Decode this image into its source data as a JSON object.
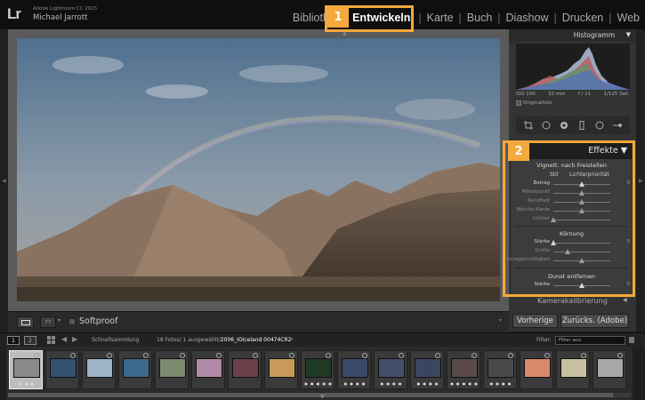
{
  "app": {
    "logo": "Lr",
    "version": "Adobe Lightroom CC 2015",
    "user": "Michael Jarrott"
  },
  "modules": {
    "library": "Bibliothek",
    "develop": "Entwickeln",
    "map": "Karte",
    "book": "Buch",
    "slideshow": "Diashow",
    "print": "Drucken",
    "web": "Web"
  },
  "callouts": {
    "one": "1",
    "two": "2"
  },
  "toolbar": {
    "yy_label": "YY",
    "softproof": "Softproof"
  },
  "histogram": {
    "title": "Histogramm",
    "iso": "ISO 100",
    "focal": "32 mm",
    "aperture": "f / 11",
    "shutter": "1/125 Sek.",
    "original_photo": "Originalfoto"
  },
  "effects": {
    "title": "Effekte",
    "vignette_title": "Vignett. nach Freistellen",
    "style_label": "Stil",
    "style_value": "Lichterpriorität",
    "vignette_rows": [
      {
        "label": "Betrag",
        "value": "0",
        "level": 0.5,
        "active": true
      },
      {
        "label": "Mittelpunkt",
        "value": "",
        "level": 0.5,
        "active": false
      },
      {
        "label": "Rundheit",
        "value": "",
        "level": 0.5,
        "active": false
      },
      {
        "label": "Weiche Kante",
        "value": "",
        "level": 0.5,
        "active": false
      },
      {
        "label": "Lichter",
        "value": "",
        "level": 0.0,
        "active": false
      }
    ],
    "grain_title": "Körnung",
    "grain_rows": [
      {
        "label": "Stärke",
        "value": "0",
        "level": 0.0,
        "active": true
      },
      {
        "label": "Größe",
        "value": "",
        "level": 0.25,
        "active": false
      },
      {
        "label": "Unregelmäßigkeit",
        "value": "",
        "level": 0.5,
        "active": false
      }
    ],
    "dehaze_title": "Dunst entfernen",
    "dehaze_rows": [
      {
        "label": "Stärke",
        "value": "0",
        "level": 0.5,
        "active": true
      }
    ]
  },
  "calibration": {
    "label": "Kamerakalibrierung"
  },
  "buttons": {
    "previous": "Vorherige",
    "reset": "Zurücks. (Adobe)"
  },
  "filmbar": {
    "screen1": "1",
    "screen2": "2",
    "collection": "Schnellsammlung",
    "count": "18 Fotos/ 1 ausgewählt/",
    "file": "2006_IOIceland 00474CR2",
    "filter_label": "Filter:",
    "filter_value": "Filter aus"
  },
  "filmstrip": {
    "thumbs": [
      {
        "color": "#8a8a8a",
        "stars": "● ● ●",
        "selected": true
      },
      {
        "color": "#35506e",
        "stars": "",
        "selected": false
      },
      {
        "color": "#9cb3c7",
        "stars": "",
        "selected": false
      },
      {
        "color": "#3c6a8f",
        "stars": "",
        "selected": false
      },
      {
        "color": "#7a8b70",
        "stars": "",
        "selected": false
      },
      {
        "color": "#b08aa8",
        "stars": "",
        "selected": false
      },
      {
        "color": "#6b3e4a",
        "stars": "",
        "selected": false
      },
      {
        "color": "#c79a5a",
        "stars": "",
        "selected": false
      },
      {
        "color": "#1f3a22",
        "stars": "● ● ● ● ●",
        "selected": false
      },
      {
        "color": "#3a4a6a",
        "stars": "● ● ● ●",
        "selected": false
      },
      {
        "color": "#44506a",
        "stars": "● ● ● ●",
        "selected": false
      },
      {
        "color": "#3a4560",
        "stars": "● ● ● ●",
        "selected": false
      },
      {
        "color": "#5a4a4a",
        "stars": "● ● ● ● ●",
        "selected": false
      },
      {
        "color": "#4a4a4a",
        "stars": "● ● ● ●",
        "selected": false
      },
      {
        "color": "#d98a6a",
        "stars": "",
        "selected": false
      },
      {
        "color": "#c8c0a0",
        "stars": "",
        "selected": false
      },
      {
        "color": "#a8a8a8",
        "stars": "",
        "selected": false
      }
    ]
  }
}
